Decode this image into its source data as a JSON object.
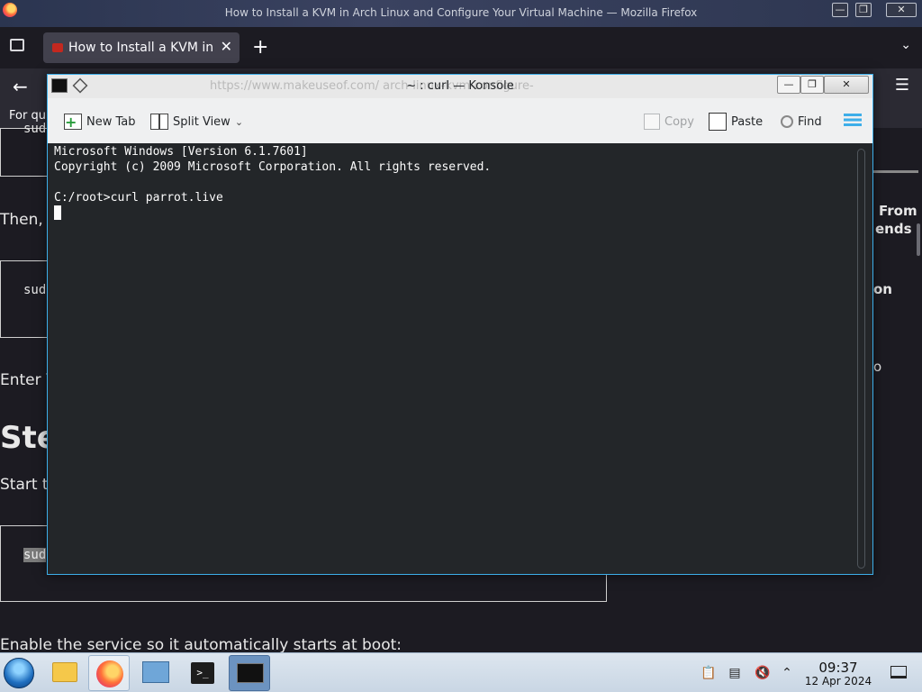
{
  "firefox": {
    "window_title": "How to Install a KVM in Arch Linux and Configure Your Virtual Machine — Mozilla Firefox",
    "tab_label": "How to Install a KVM in A",
    "tab_close": "✕",
    "new_tab": "+",
    "tab_overflow": "⌄",
    "back": "←",
    "menu": "☰",
    "bookmarks_hint": "For qu",
    "article": {
      "code_1": "sud",
      "para_then": "Then, r",
      "code_2": "sud",
      "para_enter": "Enter Y",
      "heading_step": "Ste",
      "para_start": "Start t",
      "code_3": "sud",
      "para_enable": "Enable the service so it automatically starts at boot:",
      "side_1": "From",
      "side_2": "ends",
      "side_3": "on",
      "side_4": "o"
    },
    "wm_buttons": [
      "—",
      "❐",
      "✕"
    ]
  },
  "konsole": {
    "title": "~ : curl — Konsole",
    "ghost_url": "https://www.makeuseof.com/                    arch-linux-kvm-configure-",
    "wm_buttons": [
      "—",
      "❐",
      "✕"
    ],
    "toolbar": {
      "new_tab": "New Tab",
      "split_view": "Split View",
      "copy": "Copy",
      "paste": "Paste",
      "find": "Find"
    },
    "terminal": {
      "lines": [
        "Microsoft Windows [Version 6.1.7601]",
        "Copyright (c) 2009 Microsoft Corporation. All rights reserved.",
        "",
        "C:/root>curl parrot.live"
      ]
    }
  },
  "taskbar": {
    "clock_time": "09:37",
    "clock_date": "12 Apr 2024",
    "terminal_glyph": ">_"
  }
}
